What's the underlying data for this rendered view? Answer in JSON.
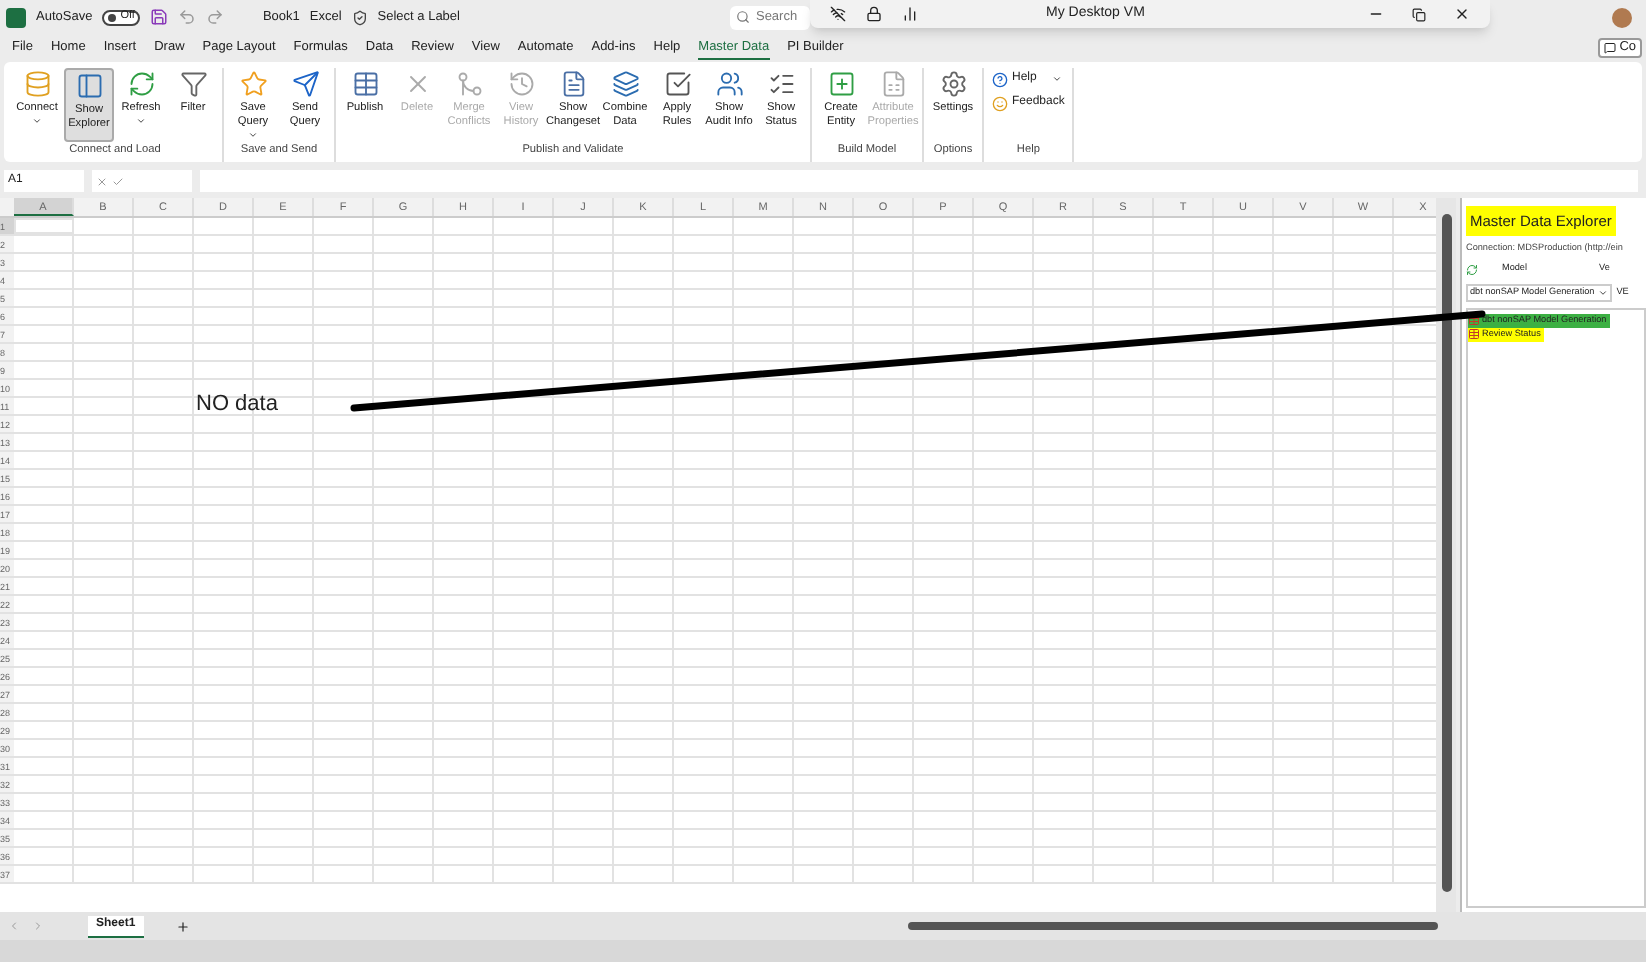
{
  "title_bar": {
    "autosave_label": "AutoSave",
    "autosave": {
      "on": false,
      "label": "Off"
    },
    "document": "Book1",
    "app": "Excel",
    "sensitivity": "Select a Label",
    "search_placeholder": "Search"
  },
  "remote_bar": {
    "title": "My Desktop VM"
  },
  "menu_tabs": [
    {
      "label": "File",
      "selected": false
    },
    {
      "label": "Home",
      "selected": false
    },
    {
      "label": "Insert",
      "selected": false
    },
    {
      "label": "Draw",
      "selected": false
    },
    {
      "label": "Page Layout",
      "selected": false
    },
    {
      "label": "Formulas",
      "selected": false
    },
    {
      "label": "Data",
      "selected": false
    },
    {
      "label": "Review",
      "selected": false
    },
    {
      "label": "View",
      "selected": false
    },
    {
      "label": "Automate",
      "selected": false
    },
    {
      "label": "Add-ins",
      "selected": false
    },
    {
      "label": "Help",
      "selected": false
    },
    {
      "label": "Master Data",
      "selected": true
    },
    {
      "label": "PI Builder",
      "selected": false
    }
  ],
  "comments_button": "Co",
  "ribbon_groups": [
    {
      "label": "Connect and Load",
      "buttons": [
        {
          "kind": "large",
          "label": "Connect",
          "dropdown": true,
          "selected": false,
          "disabled": false
        },
        {
          "kind": "large",
          "label": "Show Explorer",
          "dropdown": false,
          "selected": true,
          "disabled": false
        },
        {
          "kind": "large",
          "label": "Refresh",
          "dropdown": true,
          "selected": false,
          "disabled": false
        },
        {
          "kind": "large",
          "label": "Filter",
          "dropdown": false,
          "selected": false,
          "disabled": false
        }
      ]
    },
    {
      "label": "Save and Send",
      "buttons": [
        {
          "kind": "large",
          "label": "Save Query",
          "dropdown": true,
          "selected": false,
          "disabled": false
        },
        {
          "kind": "large",
          "label": "Send Query",
          "dropdown": false,
          "selected": false,
          "disabled": false
        }
      ]
    },
    {
      "label": "Publish and Validate",
      "buttons": [
        {
          "kind": "large",
          "label": "Publish",
          "dropdown": false,
          "selected": false,
          "disabled": false
        },
        {
          "kind": "large",
          "label": "Delete",
          "dropdown": false,
          "selected": false,
          "disabled": true
        },
        {
          "kind": "large",
          "label": "Merge Conflicts",
          "dropdown": false,
          "selected": false,
          "disabled": true
        },
        {
          "kind": "large",
          "label": "View History",
          "dropdown": false,
          "selected": false,
          "disabled": true
        },
        {
          "kind": "large",
          "label": "Show Changeset",
          "dropdown": false,
          "selected": false,
          "disabled": false
        },
        {
          "kind": "large",
          "label": "Combine Data",
          "dropdown": false,
          "selected": false,
          "disabled": false
        },
        {
          "kind": "large",
          "label": "Apply Rules",
          "dropdown": false,
          "selected": false,
          "disabled": false
        },
        {
          "kind": "large",
          "label": "Show Audit Info",
          "dropdown": false,
          "selected": false,
          "disabled": false
        },
        {
          "kind": "large",
          "label": "Show Status",
          "dropdown": false,
          "selected": false,
          "disabled": false
        }
      ]
    },
    {
      "label": "Build Model",
      "buttons": [
        {
          "kind": "large",
          "label": "Create Entity",
          "dropdown": false,
          "selected": false,
          "disabled": false
        },
        {
          "kind": "large",
          "label": "Attribute Properties",
          "dropdown": false,
          "selected": false,
          "disabled": true
        }
      ]
    },
    {
      "label": "Options",
      "buttons": [
        {
          "kind": "large",
          "label": "Settings",
          "dropdown": false,
          "selected": false,
          "disabled": false
        }
      ]
    },
    {
      "label": "Help",
      "buttons": [
        {
          "kind": "small",
          "label": "Help",
          "dropdown": true,
          "selected": false,
          "disabled": false
        },
        {
          "kind": "small",
          "label": "Feedback",
          "dropdown": false,
          "selected": false,
          "disabled": false
        }
      ]
    }
  ],
  "formula_bar": {
    "name_box": "A1"
  },
  "columns": [
    {
      "label": "A",
      "selected": true
    },
    {
      "label": "B",
      "selected": false
    },
    {
      "label": "C",
      "selected": false
    },
    {
      "label": "D",
      "selected": false
    },
    {
      "label": "E",
      "selected": false
    },
    {
      "label": "F",
      "selected": false
    },
    {
      "label": "G",
      "selected": false
    },
    {
      "label": "H",
      "selected": false
    },
    {
      "label": "I",
      "selected": false
    },
    {
      "label": "J",
      "selected": false
    },
    {
      "label": "K",
      "selected": false
    },
    {
      "label": "L",
      "selected": false
    },
    {
      "label": "M",
      "selected": false
    },
    {
      "label": "N",
      "selected": false
    },
    {
      "label": "O",
      "selected": false
    },
    {
      "label": "P",
      "selected": false
    },
    {
      "label": "Q",
      "selected": false
    },
    {
      "label": "R",
      "selected": false
    },
    {
      "label": "S",
      "selected": false
    },
    {
      "label": "T",
      "selected": false
    },
    {
      "label": "U",
      "selected": false
    },
    {
      "label": "V",
      "selected": false
    },
    {
      "label": "W",
      "selected": false
    },
    {
      "label": "X",
      "selected": false
    }
  ],
  "rows": [
    {
      "label": "1",
      "selected": true
    },
    {
      "label": "2",
      "selected": false
    },
    {
      "label": "3",
      "selected": false
    },
    {
      "label": "4",
      "selected": false
    },
    {
      "label": "5",
      "selected": false
    },
    {
      "label": "6",
      "selected": false
    },
    {
      "label": "7",
      "selected": false
    },
    {
      "label": "8",
      "selected": false
    },
    {
      "label": "9",
      "selected": false
    },
    {
      "label": "10",
      "selected": false
    },
    {
      "label": "11",
      "selected": false
    },
    {
      "label": "12",
      "selected": false
    },
    {
      "label": "13",
      "selected": false
    },
    {
      "label": "14",
      "selected": false
    },
    {
      "label": "15",
      "selected": false
    },
    {
      "label": "16",
      "selected": false
    },
    {
      "label": "17",
      "selected": false
    },
    {
      "label": "18",
      "selected": false
    },
    {
      "label": "19",
      "selected": false
    },
    {
      "label": "20",
      "selected": false
    },
    {
      "label": "21",
      "selected": false
    },
    {
      "label": "22",
      "selected": false
    },
    {
      "label": "23",
      "selected": false
    },
    {
      "label": "24",
      "selected": false
    },
    {
      "label": "25",
      "selected": false
    },
    {
      "label": "26",
      "selected": false
    },
    {
      "label": "27",
      "selected": false
    },
    {
      "label": "28",
      "selected": false
    },
    {
      "label": "29",
      "selected": false
    },
    {
      "label": "30",
      "selected": false
    },
    {
      "label": "31",
      "selected": false
    },
    {
      "label": "32",
      "selected": false
    },
    {
      "label": "33",
      "selected": false
    },
    {
      "label": "34",
      "selected": false
    },
    {
      "label": "35",
      "selected": false
    },
    {
      "label": "36",
      "selected": false
    },
    {
      "label": "37",
      "selected": false
    }
  ],
  "annotation": {
    "text": "NO data"
  },
  "explorer": {
    "title": "Master Data Explorer",
    "title_highlighted": true,
    "connection": "Connection: MDSProduction (http://ein",
    "model_label": "Model",
    "version_label": "Ve",
    "model_value": "dbt nonSAP Model Generation",
    "version_value": "VE",
    "items": [
      {
        "label": "dbt nonSAP Model Generation",
        "selected": true,
        "highlighted": true
      },
      {
        "label": "Review Status",
        "selected": false,
        "highlighted": true
      }
    ]
  },
  "sheet_tabs": [
    {
      "label": "Sheet1",
      "selected": true
    }
  ]
}
